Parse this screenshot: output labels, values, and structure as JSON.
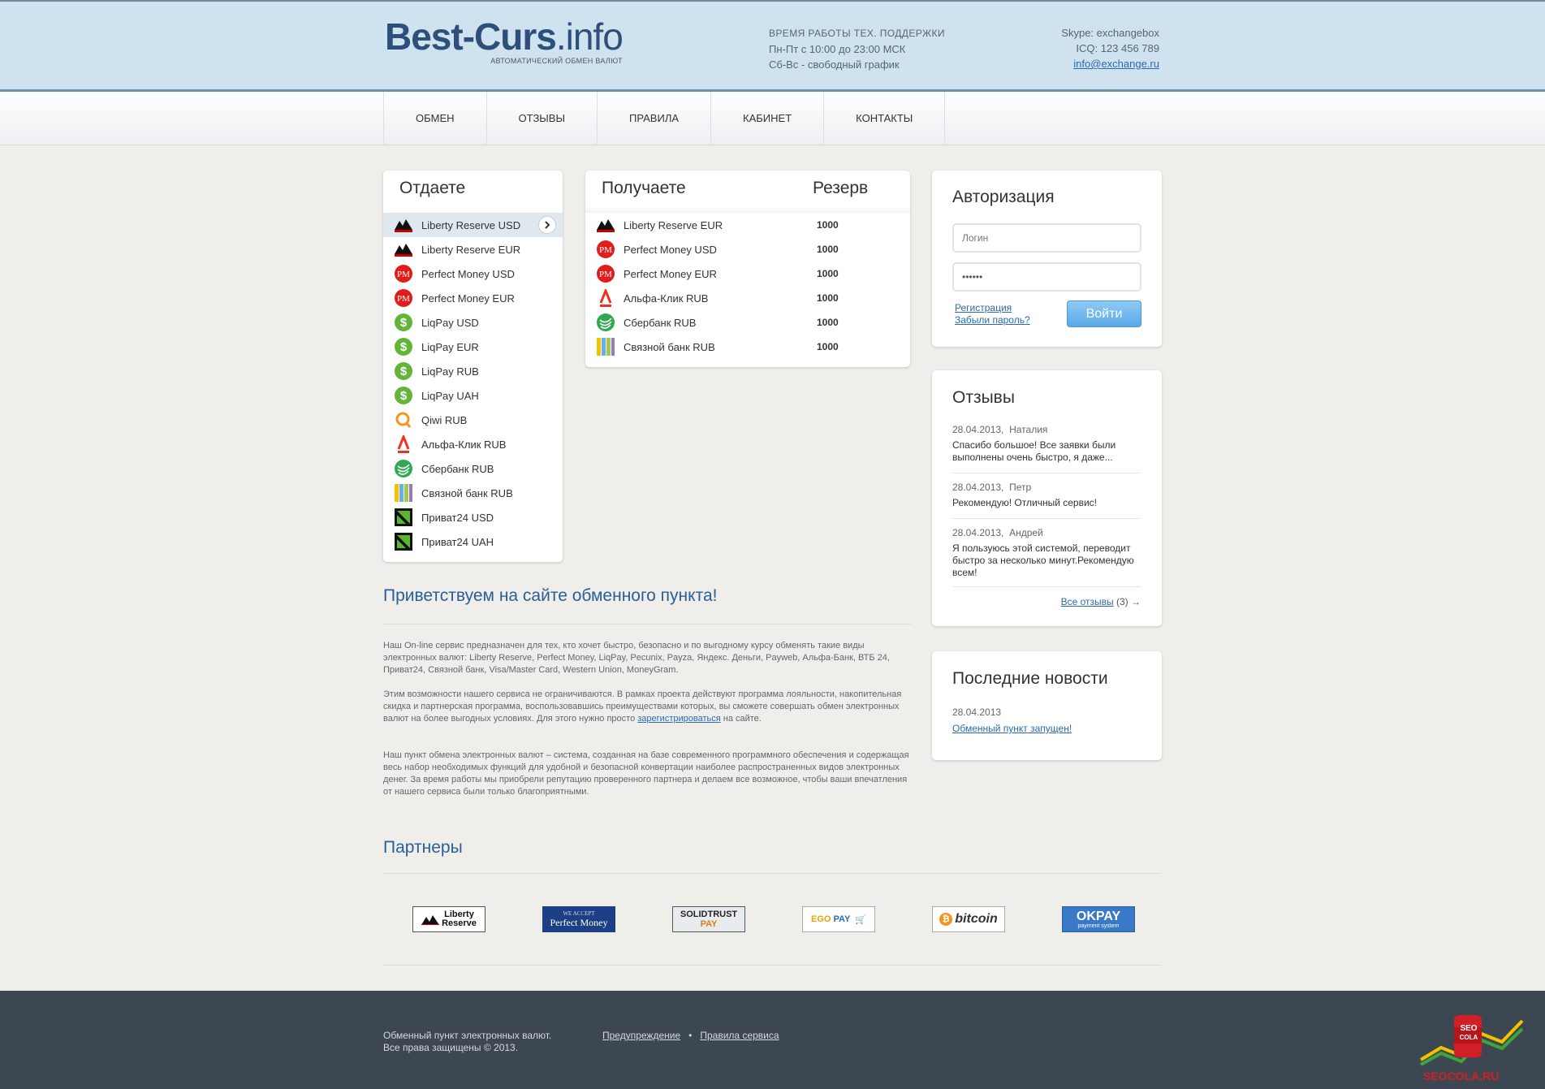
{
  "header": {
    "logo_main": "Best-Curs",
    "logo_tld": ".info",
    "logo_sub": "АВТОМАТИЧЕСКИЙ ОБМЕН ВАЛЮТ",
    "support_title": "ВРЕМЯ РАБОТЫ ТЕХ. ПОДДЕРЖКИ",
    "support_weekdays": "Пн-Пт с 10:00 до 23:00 МСК",
    "support_weekend": "Сб-Вс - свободный график",
    "skype": "Skype: exchangebox",
    "icq": "ICQ: 123 456 789",
    "email": "info@exchange.ru"
  },
  "nav": {
    "items": [
      {
        "label": "ОБМЕН"
      },
      {
        "label": "ОТЗЫВЫ"
      },
      {
        "label": "ПРАВИЛА"
      },
      {
        "label": "КАБИНЕТ"
      },
      {
        "label": "КОНТАКТЫ"
      }
    ]
  },
  "give": {
    "title": "Отдаете",
    "items": [
      {
        "label": "Liberty Reserve USD",
        "icon": "liberty-reserve-icon"
      },
      {
        "label": "Liberty Reserve EUR",
        "icon": "liberty-reserve-icon"
      },
      {
        "label": "Perfect Money USD",
        "icon": "perfect-money-icon"
      },
      {
        "label": "Perfect Money EUR",
        "icon": "perfect-money-icon"
      },
      {
        "label": "LiqPay USD",
        "icon": "liqpay-icon"
      },
      {
        "label": "LiqPay EUR",
        "icon": "liqpay-icon"
      },
      {
        "label": "LiqPay RUB",
        "icon": "liqpay-icon"
      },
      {
        "label": "LiqPay UAH",
        "icon": "liqpay-icon"
      },
      {
        "label": "Qiwi RUB",
        "icon": "qiwi-icon"
      },
      {
        "label": "Альфа-Клик RUB",
        "icon": "alfa-click-icon"
      },
      {
        "label": "Сбербанк RUB",
        "icon": "sberbank-icon"
      },
      {
        "label": "Связной банк RUB",
        "icon": "svyaznoy-icon"
      },
      {
        "label": "Приват24 USD",
        "icon": "privat24-icon"
      },
      {
        "label": "Приват24 UAH",
        "icon": "privat24-icon"
      }
    ]
  },
  "receive": {
    "title": "Получаете",
    "reserve_title": "Резерв",
    "items": [
      {
        "label": "Liberty Reserve EUR",
        "reserve": "1000",
        "icon": "liberty-reserve-icon"
      },
      {
        "label": "Perfect Money USD",
        "reserve": "1000",
        "icon": "perfect-money-icon"
      },
      {
        "label": "Perfect Money EUR",
        "reserve": "1000",
        "icon": "perfect-money-icon"
      },
      {
        "label": "Альфа-Клик RUB",
        "reserve": "1000",
        "icon": "alfa-click-icon"
      },
      {
        "label": "Сбербанк RUB",
        "reserve": "1000",
        "icon": "sberbank-icon"
      },
      {
        "label": "Связной банк RUB",
        "reserve": "1000",
        "icon": "svyaznoy-icon"
      }
    ]
  },
  "auth": {
    "title": "Авторизация",
    "login_placeholder": "Логин",
    "password_value": "••••••",
    "register": "Регистрация",
    "forgot": "Забыли пароль?",
    "submit": "Войти"
  },
  "reviews": {
    "title": "Отзывы",
    "items": [
      {
        "date": "28.04.2013,",
        "name": "Наталия",
        "text": "Спасибо большое! Все заявки были выполнены очень быстро, я даже..."
      },
      {
        "date": "28.04.2013,",
        "name": "Петр",
        "text": "Рекомендую! Отличный сервис!"
      },
      {
        "date": "28.04.2013,",
        "name": "Андрей",
        "text": "Я пользуюсь этой системой, переводит быстро за несколько минут.Рекомендую всем!"
      }
    ],
    "all_link": "Все отзывы",
    "all_count": "(3)",
    "arrow": "→"
  },
  "news": {
    "title": "Последние новости",
    "date": "28.04.2013",
    "link": "Обменный пункт запущен!"
  },
  "main": {
    "welcome": "Приветствуем на сайте обменного пункта!",
    "p1": "Наш On-line сервис предназначен для тех, кто хочет быстро, безопасно и по выгодному курсу обменять такие виды электронных валют: Liberty Reserve, Perfect Money, LiqPay, Pecunix, Payza, Яндекс. Деньги, Payweb, Альфа-Банк, ВТБ 24, Приват24, Связной банк, Visa/Master Card, Western Union, MoneyGram.",
    "p2_before": "Этим возможности нашего сервиса не ограничиваются. В рамках проекта действуют программа лояльности, накопительная скидка и партнерская программа, воспользовавшись преимуществами которых, вы сможете совершать обмен электронных валют на более выгодных условиях. Для этого нужно просто ",
    "p2_link": "зарегистрироваться",
    "p2_after": " на сайте.",
    "p3": "Наш пункт обмена электронных валют – система, созданная на базе современного программного обеспечения и содержащая весь набор необходимых функций для удобной и безопасной конвертации наиболее распространенных видов электронных денег. За время работы мы приобрели репутацию проверенного партнера и делаем все возможное, чтобы ваши впечатления от нашего сервиса были только благоприятными."
  },
  "partners": {
    "title": "Партнеры",
    "items": [
      {
        "line1": "Liberty",
        "line2": "Reserve"
      },
      {
        "line1": "WE ACCEPT",
        "line2": "Perfect Money"
      },
      {
        "line1": "SOLIDTRUST",
        "line2": "PAY"
      },
      {
        "line1": "EGO",
        "line2": "PAY"
      },
      {
        "line1": "bitcoin",
        "line2": ""
      },
      {
        "line1": "OKPAY",
        "line2": "payment system"
      }
    ]
  },
  "footer": {
    "line1": "Обменный пункт электронных валют.",
    "line2": "Все права защищены © 2013.",
    "link1": "Предупреждение",
    "dot": "•",
    "link2": "Правила сервиса",
    "seo_top": "SEO",
    "seo_mid": "COLA",
    "seo_url": "SEOCOLA.RU"
  }
}
